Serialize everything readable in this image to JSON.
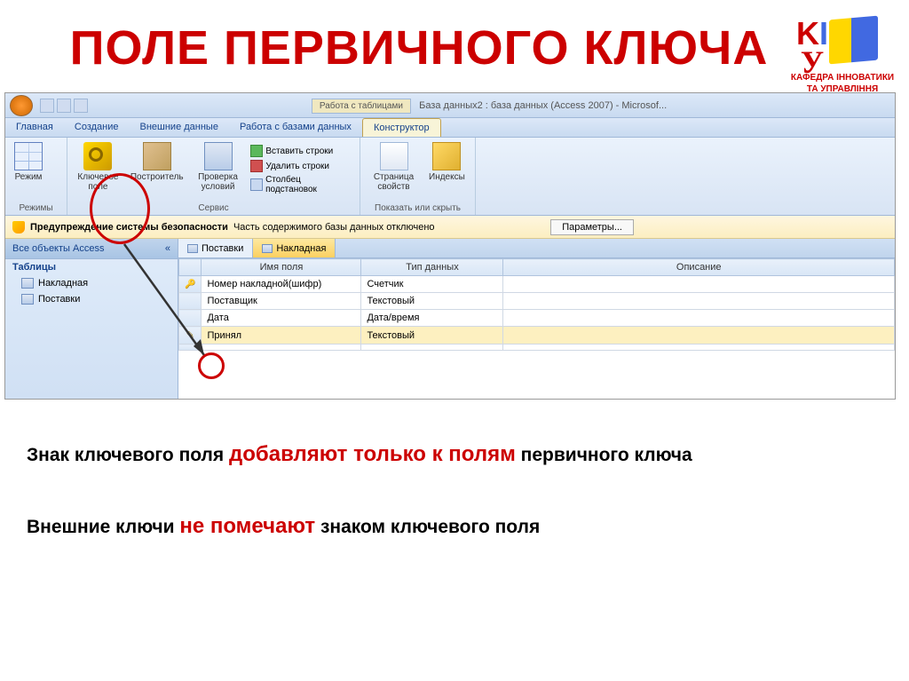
{
  "slide": {
    "title": "ПОЛЕ ПЕРВИЧНОГО КЛЮЧА",
    "logo_caption1": "КАФЕДРА ІННОВАТИКИ",
    "logo_caption2": "ТА УПРАВЛІННЯ"
  },
  "titlebar": {
    "context_tab": "Работа с таблицами",
    "window_title": "База данных2 : база данных (Access 2007) - Microsof..."
  },
  "ribbon": {
    "tabs": {
      "home": "Главная",
      "create": "Создание",
      "external": "Внешние данные",
      "dbtools": "Работа с базами данных",
      "design": "Конструктор"
    },
    "groups": {
      "modes": "Режимы",
      "service": "Сервис",
      "showhide": "Показать или скрыть"
    },
    "buttons": {
      "mode": "Режим",
      "key_field": "Ключевое поле",
      "builder": "Построитель",
      "validation": "Проверка условий",
      "insert_rows": "Вставить строки",
      "delete_rows": "Удалить строки",
      "lookup_col": "Столбец подстановок",
      "prop_sheet": "Страница свойств",
      "indexes": "Индексы"
    }
  },
  "security": {
    "warning_label": "Предупреждение системы безопасности",
    "warning_text": "Часть содержимого базы данных отключено",
    "params_btn": "Параметры..."
  },
  "nav": {
    "header": "Все объекты Access",
    "section": "Таблицы",
    "items": [
      "Накладная",
      "Поставки"
    ]
  },
  "doctabs": [
    "Поставки",
    "Накладная"
  ],
  "design_table": {
    "headers": {
      "field_name": "Имя поля",
      "data_type": "Тип данных",
      "description": "Описание"
    },
    "rows": [
      {
        "key": true,
        "name": "Номер накладной(шифр)",
        "type": "Счетчик"
      },
      {
        "key": false,
        "name": "Поставщик",
        "type": "Текстовый"
      },
      {
        "key": false,
        "name": "Дата",
        "type": "Дата/время"
      },
      {
        "key": false,
        "name": "Принял",
        "type": "Текстовый",
        "active": true
      }
    ]
  },
  "text": {
    "line1_pre": "Знак ключевого поля ",
    "line1_red": "добавляют только к полям",
    "line1_post": " первичного ключа",
    "line2_pre": "Внешние ключи ",
    "line2_red": "не помечают",
    "line2_post": " знаком ключевого поля"
  }
}
